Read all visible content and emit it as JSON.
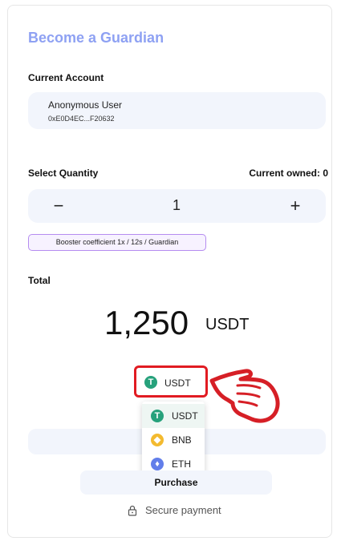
{
  "form": {
    "title": "Become a Guardian",
    "account_label": "Current Account",
    "account_name": "Anonymous User",
    "account_address": "0xE0D4EC...F20632",
    "quantity_label": "Select Quantity",
    "owned_label": "Current owned: 0",
    "decrement_symbol": "−",
    "quantity_value": "1",
    "increment_symbol": "+",
    "booster_text": "Booster coefficient 1x / 12s / Guardian",
    "total_label": "Total",
    "total_amount": "1,250",
    "total_currency": "USDT",
    "purchase_label": "Purchase",
    "secure_label": "Secure payment"
  },
  "token_select": {
    "selected_label": "USDT",
    "highlight_color": "#e11b22",
    "options": [
      {
        "label": "USDT",
        "icon": "tether-icon",
        "color": "#26a17b"
      },
      {
        "label": "BNB",
        "icon": "bnb-icon",
        "color": "#f3ba2f"
      },
      {
        "label": "ETH",
        "icon": "ethereum-icon",
        "color": "#627eea"
      }
    ]
  },
  "colors": {
    "title": "#8ea1f3",
    "panel_background": "#f2f5fc",
    "booster_border": "#b58cf0"
  }
}
